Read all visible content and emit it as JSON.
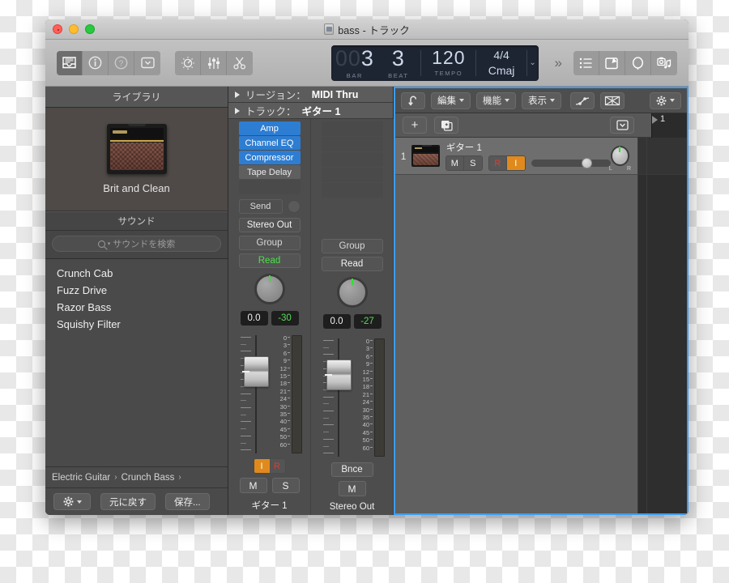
{
  "window": {
    "title": "bass - トラック",
    "doc_icon": "document-icon"
  },
  "toolbar": {
    "left_buttons": [
      {
        "name": "library-button",
        "icon": "library-drawer-icon",
        "active": true
      },
      {
        "name": "inspector-button",
        "icon": "info-circle-icon",
        "active": false
      },
      {
        "name": "help-button",
        "icon": "question-circle-icon",
        "active": false
      },
      {
        "name": "quick-help-button",
        "icon": "box-chevron-down-icon",
        "active": false
      }
    ],
    "mid_buttons": [
      {
        "name": "metronome-button",
        "icon": "metronome-icon"
      },
      {
        "name": "mixer-button",
        "icon": "sliders-icon"
      },
      {
        "name": "scissors-button",
        "icon": "scissors-icon"
      }
    ],
    "overflow_label": "»",
    "right_buttons": [
      {
        "name": "list-editors-button",
        "icon": "list-icon"
      },
      {
        "name": "notes-button",
        "icon": "pencil-box-icon"
      },
      {
        "name": "loops-button",
        "icon": "loop-oval-icon"
      },
      {
        "name": "media-button",
        "icon": "media-browser-icon"
      }
    ]
  },
  "lcd": {
    "bar_dim": "00",
    "bar_value": "3",
    "bar_label": "BAR",
    "beat_value": "3",
    "beat_label": "BEAT",
    "tempo_value": "120",
    "tempo_label": "TEMPO",
    "time_signature": "4/4",
    "key_signature": "Cmaj",
    "chevron": "⌄"
  },
  "library": {
    "header": "ライブラリ",
    "patch_name": "Brit and Clean",
    "patch_icon": "guitar-amp-icon",
    "section_header": "サウンド",
    "search_placeholder": "サウンドを検索",
    "search_icon": "search-icon",
    "items": [
      {
        "label": "Crunch Cab"
      },
      {
        "label": "Fuzz Drive"
      },
      {
        "label": "Razor Bass"
      },
      {
        "label": "Squishy Filter"
      }
    ],
    "breadcrumbs": [
      "Electric Guitar",
      "Crunch Bass"
    ],
    "footer": {
      "gear_icon": "gear-icon",
      "undo_label": "元に戻す",
      "save_label": "保存..."
    }
  },
  "inspector": {
    "region_header_label": "リージョン：",
    "region_header_value": "MIDI Thru",
    "track_header_label": "トラック：",
    "track_header_value": "ギター 1",
    "strips": [
      {
        "name": "channel-strip-guitar",
        "slots": [
          {
            "label": "Amp",
            "state": "blue"
          },
          {
            "label": "Channel EQ",
            "state": "blue"
          },
          {
            "label": "Compressor",
            "state": "blue"
          },
          {
            "label": "Tape Delay",
            "state": "gray"
          }
        ],
        "send_label": "Send",
        "output_label": "Stereo Out",
        "group_label": "Group",
        "automation_label": "Read",
        "automation_color": "green",
        "gain_value": "0.0",
        "pan_value": "-30",
        "record_label": "I",
        "input_label": "R",
        "mute_label": "M",
        "solo_label": "S",
        "strip_name": "ギター 1"
      },
      {
        "name": "channel-strip-stereo-out",
        "slots": [],
        "group_label": "Group",
        "automation_label": "Read",
        "automation_color": "white",
        "gain_value": "0.0",
        "pan_value": "-27",
        "bounce_label": "Bnce",
        "mute_label": "M",
        "strip_name": "Stereo Out"
      }
    ],
    "meter_scale": [
      "0",
      "3",
      "6",
      "9",
      "12",
      "15",
      "18",
      "21",
      "24",
      "30",
      "35",
      "40",
      "45",
      "50",
      "60"
    ]
  },
  "tracks": {
    "toolbar": {
      "back_icon": "back-arrow-icon",
      "menus": [
        {
          "label": "編集",
          "name": "edit-menu"
        },
        {
          "label": "機能",
          "name": "functions-menu"
        },
        {
          "label": "表示",
          "name": "view-menu"
        }
      ],
      "automation_icon": "automation-curve-icon",
      "flex_icon": "flex-time-icon",
      "gear_icon": "gear-icon"
    },
    "subbar": {
      "add_track_label": "+",
      "duplicate_icon": "duplicate-track-icon",
      "collapse_icon": "box-chevron-down-icon"
    },
    "ruler": {
      "bar_number": "1",
      "playhead_icon": "playhead-icon"
    },
    "rows": [
      {
        "number": "1",
        "name": "ギター 1",
        "icon": "guitar-amp-icon",
        "mute_label": "M",
        "solo_label": "S",
        "record_label": "R",
        "input_label": "I",
        "pan_left": "L",
        "pan_right": "R"
      }
    ]
  },
  "colors": {
    "accent_blue": "#2d7dd2",
    "selection_border": "#3b9df5",
    "record_orange": "#e08a1e",
    "record_red": "#e23b2e",
    "automation_green": "#4ce04c",
    "lcd_bg": "#1e2532",
    "lcd_text": "#cdd8e8"
  }
}
